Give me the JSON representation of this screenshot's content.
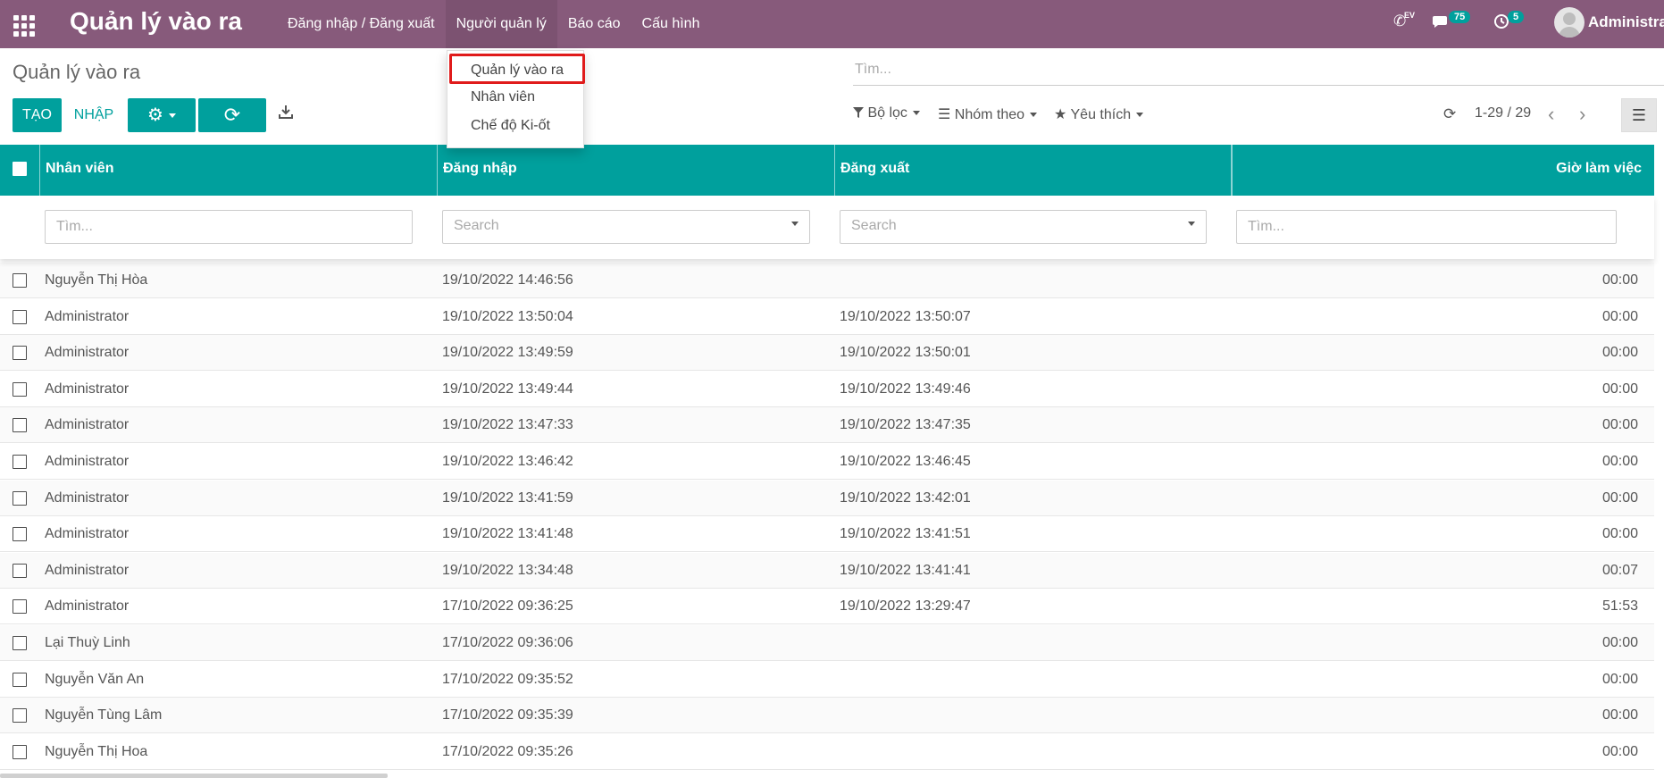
{
  "navbar": {
    "brand": "Quản lý vào ra",
    "menu": [
      {
        "label": "Đăng nhập / Đăng xuất",
        "active": false
      },
      {
        "label": "Người quản lý",
        "active": true
      },
      {
        "label": "Báo cáo",
        "active": false
      },
      {
        "label": "Cấu hình",
        "active": false
      }
    ],
    "phone_icon_label": "EV",
    "messages_badge": "75",
    "activities_badge": "5",
    "user_name": "Administrator"
  },
  "dropdown": {
    "items": [
      "Quản lý vào ra",
      "Nhân viên",
      "Chế độ Ki-ốt"
    ],
    "highlighted_index": 0,
    "highlight_color": "#e01b1b"
  },
  "control_panel": {
    "breadcrumb": "Quản lý vào ra",
    "create_label": "TẠO",
    "import_label": "NHẬP",
    "search_placeholder": "Tìm...",
    "filter_label": "Bộ lọc",
    "group_label": "Nhóm theo",
    "favorite_label": "Yêu thích",
    "pager": "1-29 / 29"
  },
  "table": {
    "columns": [
      "Nhân viên",
      "Đăng nhập",
      "Đăng xuất",
      "Giờ làm việc"
    ],
    "filter_placeholders": [
      "Tìm...",
      "Search",
      "Search",
      "Tìm..."
    ],
    "rows": [
      {
        "employee": "Nguyễn Thị Hòa",
        "check_in": "19/10/2022 14:46:56",
        "check_out": "",
        "hours": "00:00"
      },
      {
        "employee": "Administrator",
        "check_in": "19/10/2022 13:50:04",
        "check_out": "19/10/2022 13:50:07",
        "hours": "00:00"
      },
      {
        "employee": "Administrator",
        "check_in": "19/10/2022 13:49:59",
        "check_out": "19/10/2022 13:50:01",
        "hours": "00:00"
      },
      {
        "employee": "Administrator",
        "check_in": "19/10/2022 13:49:44",
        "check_out": "19/10/2022 13:49:46",
        "hours": "00:00"
      },
      {
        "employee": "Administrator",
        "check_in": "19/10/2022 13:47:33",
        "check_out": "19/10/2022 13:47:35",
        "hours": "00:00"
      },
      {
        "employee": "Administrator",
        "check_in": "19/10/2022 13:46:42",
        "check_out": "19/10/2022 13:46:45",
        "hours": "00:00"
      },
      {
        "employee": "Administrator",
        "check_in": "19/10/2022 13:41:59",
        "check_out": "19/10/2022 13:42:01",
        "hours": "00:00"
      },
      {
        "employee": "Administrator",
        "check_in": "19/10/2022 13:41:48",
        "check_out": "19/10/2022 13:41:51",
        "hours": "00:00"
      },
      {
        "employee": "Administrator",
        "check_in": "19/10/2022 13:34:48",
        "check_out": "19/10/2022 13:41:41",
        "hours": "00:07"
      },
      {
        "employee": "Administrator",
        "check_in": "17/10/2022 09:36:25",
        "check_out": "19/10/2022 13:29:47",
        "hours": "51:53"
      },
      {
        "employee": "Lại Thuỳ Linh",
        "check_in": "17/10/2022 09:36:06",
        "check_out": "",
        "hours": "00:00"
      },
      {
        "employee": "Nguyễn Văn An",
        "check_in": "17/10/2022 09:35:52",
        "check_out": "",
        "hours": "00:00"
      },
      {
        "employee": "Nguyễn Tùng Lâm",
        "check_in": "17/10/2022 09:35:39",
        "check_out": "",
        "hours": "00:00"
      },
      {
        "employee": "Nguyễn Thị Hoa",
        "check_in": "17/10/2022 09:35:26",
        "check_out": "",
        "hours": "00:00"
      }
    ]
  },
  "colors": {
    "navbar": "#875a7b",
    "primary": "#00a09d"
  }
}
